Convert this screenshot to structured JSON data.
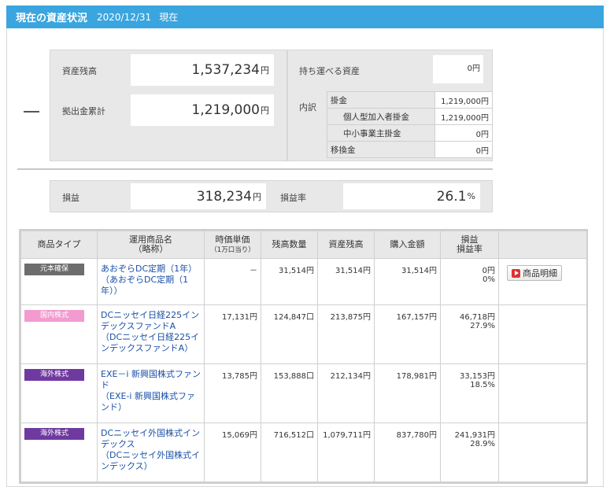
{
  "header": {
    "title": "現在の資産状況",
    "date": "2020/12/31",
    "suffix": "現在"
  },
  "summary": {
    "balance_label": "資産残高",
    "balance": "1,537,234",
    "balance_unit": "円",
    "contrib_label": "拠出金累計",
    "contrib": "1,219,000",
    "contrib_unit": "円",
    "portable_label": "持ち運べる資産",
    "portable": "0円",
    "breakdown_label": "内訳",
    "kakekin_label": "掛金",
    "kakekin": "1,219,000円",
    "individual_label": "個人型加入者掛金",
    "individual": "1,219,000円",
    "sme_label": "中小事業主掛金",
    "sme": "0円",
    "transfer_label": "移換金",
    "transfer": "0円",
    "pl_label": "損益",
    "pl": "318,234",
    "pl_unit": "円",
    "pl_rate_label": "損益率",
    "pl_rate": "26.1",
    "pl_rate_unit": "%"
  },
  "table": {
    "headers": {
      "type": "商品タイプ",
      "name": "運用商品名",
      "name_sub": "（略称）",
      "price": "時価単価",
      "price_sub": "（1万口当り）",
      "qty": "残高数量",
      "asset": "資産残高",
      "cost": "購入金額",
      "pl": "損益",
      "pl_rate": "損益率"
    },
    "detail_button": "商品明細",
    "rows": [
      {
        "type": "元本確保",
        "type_color": "#6d6d6d",
        "name": "あおぞらDC定期（1年）",
        "short": "（あおぞらDC定期（1年））",
        "price": "－",
        "qty": "31,514円",
        "asset": "31,514円",
        "cost": "31,514円",
        "pl": "0円",
        "rate": "0%"
      },
      {
        "type": "国内株式",
        "type_color": "#f39bd0",
        "name": "DCニッセイ日経225インデックスファンドA",
        "short": "（DCニッセイ日経225インデックスファンドA）",
        "price": "17,131円",
        "qty": "124,847口",
        "asset": "213,875円",
        "cost": "167,157円",
        "pl": "46,718円",
        "rate": "27.9%"
      },
      {
        "type": "海外株式",
        "type_color": "#6f3aa0",
        "name": "EXE－i 新興国株式ファンド",
        "short": "（EXE-i 新興国株式ファンド）",
        "price": "13,785円",
        "qty": "153,888口",
        "asset": "212,134円",
        "cost": "178,981円",
        "pl": "33,153円",
        "rate": "18.5%"
      },
      {
        "type": "海外株式",
        "type_color": "#6f3aa0",
        "name": "DCニッセイ外国株式インデックス",
        "short": "（DCニッセイ外国株式インデックス）",
        "price": "15,069円",
        "qty": "716,512口",
        "asset": "1,079,711円",
        "cost": "837,780円",
        "pl": "241,931円",
        "rate": "28.9%"
      }
    ]
  }
}
